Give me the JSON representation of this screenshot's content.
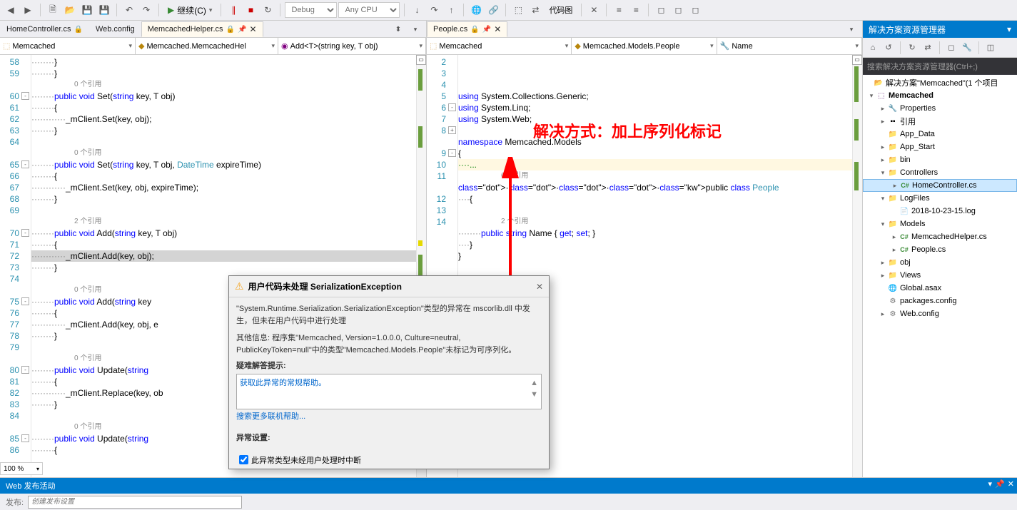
{
  "toolbar": {
    "continue": "继续(C)",
    "config": "Debug",
    "platform": "Any CPU",
    "codeMap": "代码图"
  },
  "tabs_left": [
    {
      "name": "HomeController.cs",
      "locked": true,
      "active": false
    },
    {
      "name": "Web.config",
      "locked": false,
      "active": false
    },
    {
      "name": "MemcachedHelper.cs",
      "locked": true,
      "active": true
    }
  ],
  "tabs_right": [
    {
      "name": "People.cs",
      "locked": true,
      "active": true
    }
  ],
  "nav_left": {
    "a": "Memcached",
    "b": "Memcached.MemcachedHel",
    "c": "Add<T>(string key, T obj)"
  },
  "nav_right": {
    "a": "Memcached",
    "b": "Memcached.Models.People",
    "c": "Name"
  },
  "left_code": {
    "start": 58,
    "lines": [
      {
        "n": 58,
        "t": "········}"
      },
      {
        "n": 59,
        "t": "········}"
      },
      {
        "ref": "0 个引用"
      },
      {
        "n": 60,
        "fold": "-",
        "t": "········public void Set<T>(string key, T obj)",
        "kw": [
          "public",
          "void",
          "string"
        ]
      },
      {
        "n": 61,
        "t": "········{"
      },
      {
        "n": 62,
        "t": "············_mClient.Set(key, obj);"
      },
      {
        "n": 63,
        "t": "········}"
      },
      {
        "n": 64,
        "t": ""
      },
      {
        "ref": "0 个引用"
      },
      {
        "n": 65,
        "fold": "-",
        "t": "········public void Set<T>(string key, T obj, DateTime expireTime)",
        "kw": [
          "public",
          "void",
          "string"
        ],
        "ty": [
          "DateTime"
        ]
      },
      {
        "n": 66,
        "t": "········{"
      },
      {
        "n": 67,
        "t": "············_mClient.Set(key, obj, expireTime);"
      },
      {
        "n": 68,
        "t": "········}"
      },
      {
        "n": 69,
        "t": ""
      },
      {
        "ref": "2 个引用"
      },
      {
        "n": 70,
        "fold": "-",
        "t": "········public void Add<T>(string key, T obj)",
        "kw": [
          "public",
          "void",
          "string"
        ]
      },
      {
        "n": 71,
        "t": "········{"
      },
      {
        "n": 72,
        "hl": true,
        "t": "············_mClient.Add(key, obj);"
      },
      {
        "n": 73,
        "t": "········}"
      },
      {
        "n": 74,
        "t": ""
      },
      {
        "ref": "0 个引用"
      },
      {
        "n": 75,
        "fold": "-",
        "t": "········public void Add<T>(string key",
        "kw": [
          "public",
          "void",
          "string"
        ]
      },
      {
        "n": 76,
        "t": "········{"
      },
      {
        "n": 77,
        "t": "············_mClient.Add(key, obj, e"
      },
      {
        "n": 78,
        "t": "········}"
      },
      {
        "n": 79,
        "t": ""
      },
      {
        "ref": "0 个引用"
      },
      {
        "n": 80,
        "fold": "-",
        "t": "········public void Update<T>(string",
        "kw": [
          "public",
          "void",
          "string"
        ]
      },
      {
        "n": 81,
        "t": "········{"
      },
      {
        "n": 82,
        "t": "············_mClient.Replace(key, ob"
      },
      {
        "n": 83,
        "t": "········}"
      },
      {
        "n": 84,
        "t": ""
      },
      {
        "ref": "0 个引用"
      },
      {
        "n": 85,
        "fold": "-",
        "t": "········public void Update<T>(string",
        "kw": [
          "public",
          "void",
          "string"
        ]
      },
      {
        "n": 86,
        "t": "········{"
      }
    ]
  },
  "right_code": {
    "lines": [
      {
        "n": 2,
        "t": "using System.Collections.Generic;",
        "kw": [
          "using"
        ]
      },
      {
        "n": 3,
        "t": "using System.Linq;",
        "kw": [
          "using"
        ]
      },
      {
        "n": 4,
        "t": "using System.Web;",
        "kw": [
          "using"
        ]
      },
      {
        "n": 5,
        "t": ""
      },
      {
        "n": 6,
        "fold": "-",
        "t": "namespace Memcached.Models",
        "kw": [
          "namespace"
        ]
      },
      {
        "n": 7,
        "t": "{"
      },
      {
        "n": 8,
        "fold": "+",
        "t": "····...",
        "cm": true,
        "yl": true
      },
      {
        "ref": "6 个引用"
      },
      {
        "n": 9,
        "fold": "-",
        "t": "····public class People",
        "kw": [
          "public",
          "class"
        ],
        "ty": [
          "People"
        ]
      },
      {
        "n": 10,
        "t": "····{"
      },
      {
        "n": 11,
        "t": ""
      },
      {
        "ref": "2 个引用"
      },
      {
        "n": 12,
        "t": "········public string Name { get; set; }",
        "kw": [
          "public",
          "string",
          "get",
          "set"
        ]
      },
      {
        "n": 13,
        "t": "····}"
      },
      {
        "n": 14,
        "t": "}"
      }
    ]
  },
  "annotation": "解决方式：加上序列化标记",
  "exception": {
    "title": "用户代码未处理 SerializationException",
    "line1": "\"System.Runtime.Serialization.SerializationException\"类型的异常在 mscorlib.dll 中发生，但未在用户代码中进行处理",
    "line2": "其他信息: 程序集\"Memcached, Version=1.0.0.0, Culture=neutral, PublicKeyToken=null\"中的类型\"Memcached.Models.People\"未标记为可序列化。",
    "sect_tips": "疑难解答提示:",
    "help_link": "获取此异常的常规帮助。",
    "search_link": "搜索更多联机帮助...",
    "sect_settings": "异常设置:",
    "chk_label": "此异常类型未经用户处理时中断"
  },
  "solution": {
    "title": "解决方案资源管理器",
    "search_placeholder": "搜索解决方案资源管理器(Ctrl+;)",
    "root": "解决方案\"Memcached\"(1 个项目",
    "tree": [
      {
        "d": 0,
        "exp": "▾",
        "icon": "prj",
        "label": "Memcached",
        "bold": true
      },
      {
        "d": 1,
        "exp": "▸",
        "icon": "wrench",
        "label": "Properties"
      },
      {
        "d": 1,
        "exp": "▸",
        "icon": "ref",
        "label": "引用"
      },
      {
        "d": 1,
        "exp": "",
        "icon": "folder",
        "label": "App_Data"
      },
      {
        "d": 1,
        "exp": "▸",
        "icon": "folder",
        "label": "App_Start"
      },
      {
        "d": 1,
        "exp": "▸",
        "icon": "folder",
        "label": "bin"
      },
      {
        "d": 1,
        "exp": "▾",
        "icon": "folder",
        "label": "Controllers"
      },
      {
        "d": 2,
        "exp": "▸",
        "icon": "cs",
        "label": "HomeController.cs",
        "sel": true
      },
      {
        "d": 1,
        "exp": "▾",
        "icon": "folder",
        "label": "LogFiles"
      },
      {
        "d": 2,
        "exp": "",
        "icon": "file",
        "label": "2018-10-23-15.log"
      },
      {
        "d": 1,
        "exp": "▾",
        "icon": "folder",
        "label": "Models"
      },
      {
        "d": 2,
        "exp": "▸",
        "icon": "cs",
        "label": "MemcachedHelper.cs"
      },
      {
        "d": 2,
        "exp": "▸",
        "icon": "cs",
        "label": "People.cs"
      },
      {
        "d": 1,
        "exp": "▸",
        "icon": "folder",
        "label": "obj"
      },
      {
        "d": 1,
        "exp": "▸",
        "icon": "folder",
        "label": "Views"
      },
      {
        "d": 1,
        "exp": "",
        "icon": "asax",
        "label": "Global.asax"
      },
      {
        "d": 1,
        "exp": "",
        "icon": "cfg",
        "label": "packages.config"
      },
      {
        "d": 1,
        "exp": "▸",
        "icon": "cfg",
        "label": "Web.config"
      }
    ]
  },
  "bottom": {
    "title": "Web 发布活动",
    "label": "发布:",
    "placeholder": "创建发布设置"
  },
  "zoom": "100 %"
}
